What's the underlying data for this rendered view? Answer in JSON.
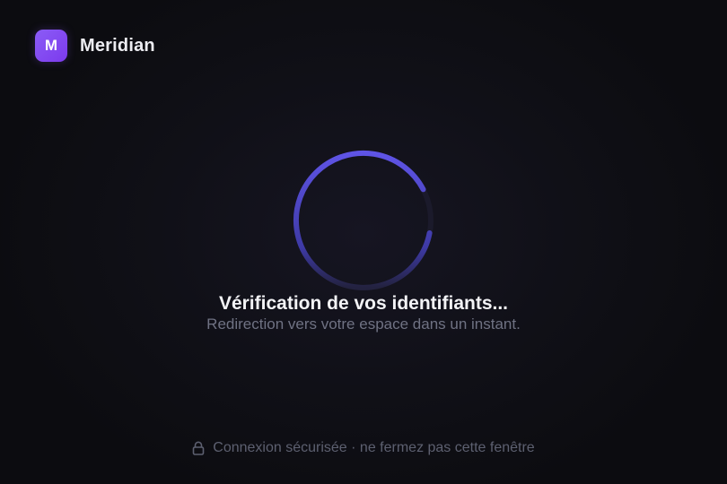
{
  "brand": {
    "logo_letter": "M",
    "name": "Meridian"
  },
  "status": {
    "title": "Vérification de vos identifiants...",
    "subtitle": "Redirection vers votre espace dans un instant."
  },
  "footer": {
    "icon": "lock-icon",
    "text": "Connexion sécurisée · ne fermez pas cette fenêtre"
  },
  "colors": {
    "accent": "#7c3aed",
    "spinner": "#5b4fd6",
    "background": "#0e0e13"
  }
}
